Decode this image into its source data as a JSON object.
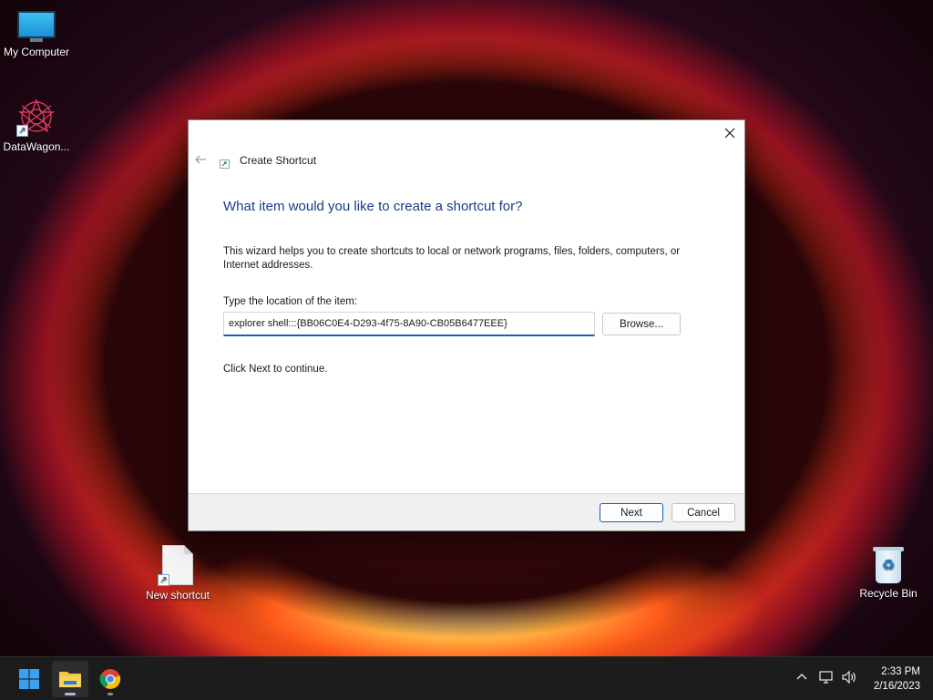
{
  "desktop": {
    "icons": [
      {
        "label": "My Computer",
        "icon": "computer-monitor-icon"
      },
      {
        "label": "DataWagon...",
        "icon": "datawagon-app-icon"
      },
      {
        "label": "New shortcut",
        "icon": "shortcut-file-icon"
      },
      {
        "label": "Recycle Bin",
        "icon": "recycle-bin-icon"
      }
    ]
  },
  "dialog": {
    "title": "Create Shortcut",
    "heading": "What item would you like to create a shortcut for?",
    "description": "This wizard helps you to create shortcuts to local or network programs, files, folders, computers, or Internet addresses.",
    "location_label": "Type the location of the item:",
    "location_value": "explorer shell:::{BB06C0E4-D293-4f75-8A90-CB05B6477EEE}",
    "browse_label": "Browse...",
    "hint": "Click Next to continue.",
    "next_label": "Next",
    "cancel_label": "Cancel",
    "close_icon": "close-icon",
    "back_icon": "back-arrow-icon"
  },
  "taskbar": {
    "items": [
      {
        "name": "start",
        "icon": "windows-start-icon"
      },
      {
        "name": "file-explorer",
        "icon": "folder-icon"
      },
      {
        "name": "chrome",
        "icon": "chrome-icon"
      }
    ],
    "tray": [
      "chevron-up-icon",
      "network-icon",
      "volume-icon"
    ],
    "time": "2:33 PM",
    "date": "2/16/2023"
  },
  "colors": {
    "accent": "#1a5fb4",
    "heading": "#1a3a8a",
    "taskbar": "#1c1c1c"
  }
}
